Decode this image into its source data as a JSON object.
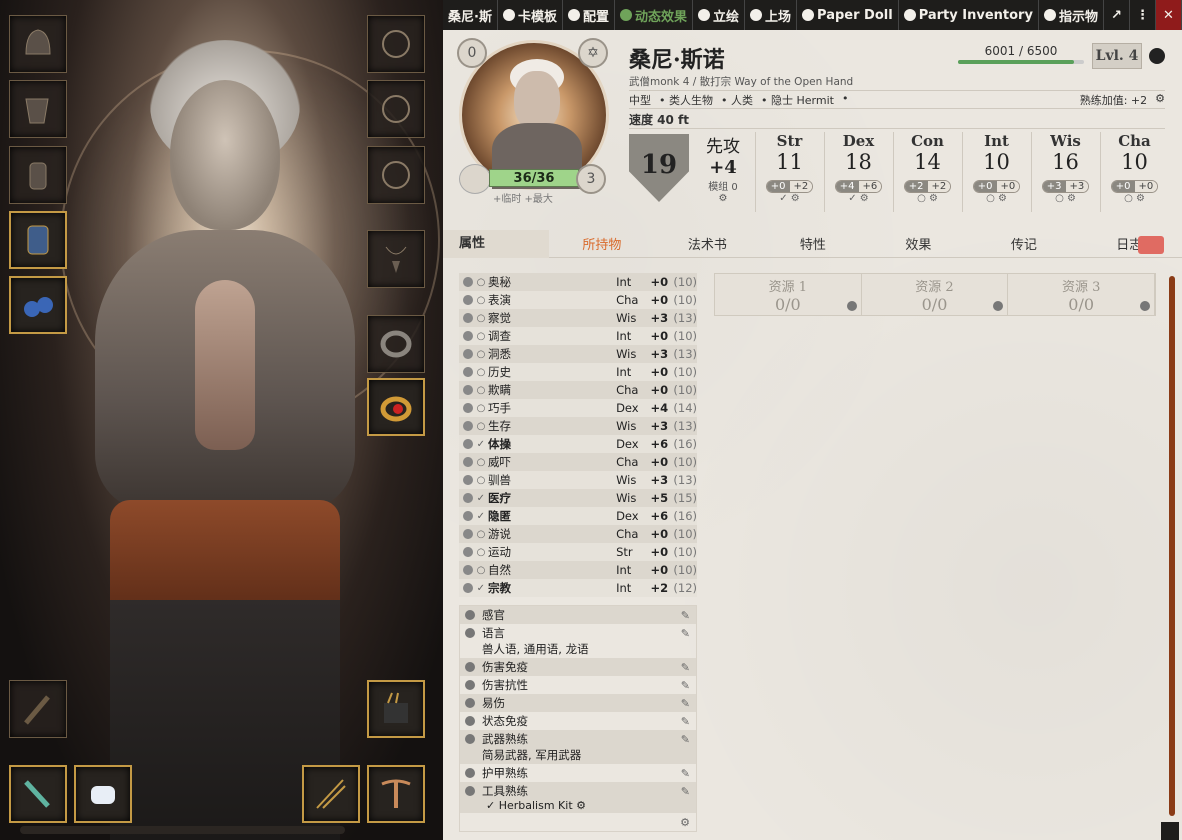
{
  "toolbar": {
    "tabs": [
      {
        "label": "桑尼·斯",
        "icon": "none"
      },
      {
        "label": "卡模板",
        "icon": "gear-icon"
      },
      {
        "label": "配置",
        "icon": "crown-icon"
      },
      {
        "label": "动态效果",
        "icon": "wrench-icon"
      },
      {
        "label": "立绘",
        "icon": "user-tie-icon"
      },
      {
        "label": "上场",
        "icon": "masks-icon"
      },
      {
        "label": "Paper Doll",
        "icon": "figure-icon"
      },
      {
        "label": "Party Inventory",
        "icon": "group-icon"
      },
      {
        "label": "指示物",
        "icon": "user-circle-icon"
      }
    ],
    "external": "↗",
    "menu": "⋮",
    "close": "✕"
  },
  "header": {
    "name": "桑尼·斯诺",
    "class_line": "武僧monk 4 / 散打宗 Way of the Open Hand",
    "inspiration": "0",
    "xp": "6001 / 6500",
    "xp_fraction": 0.923,
    "level": "Lvl. 4",
    "size": "中型",
    "type": "类人生物",
    "race": "人类",
    "background": "隐士 Hermit",
    "proficiency": "熟练加值: +2",
    "speed": "速度 40 ft",
    "hp": "36/36",
    "hit_dice": "3",
    "temp": "+临时 +最大"
  },
  "ac": "19",
  "initiative": {
    "label": "先攻",
    "value": "+4",
    "mod_label": "模组",
    "mod_value": "0"
  },
  "abilities": [
    {
      "name": "Str",
      "score": "11",
      "mod": "+0",
      "save": "+2",
      "prof": true
    },
    {
      "name": "Dex",
      "score": "18",
      "mod": "+4",
      "save": "+6",
      "prof": true
    },
    {
      "name": "Con",
      "score": "14",
      "mod": "+2",
      "save": "+2",
      "prof": false
    },
    {
      "name": "Int",
      "score": "10",
      "mod": "+0",
      "save": "+0",
      "prof": false
    },
    {
      "name": "Wis",
      "score": "16",
      "mod": "+3",
      "save": "+3",
      "prof": false
    },
    {
      "name": "Cha",
      "score": "10",
      "mod": "+0",
      "save": "+0",
      "prof": false
    }
  ],
  "tabs": [
    "属性",
    "所持物",
    "法术书",
    "特性",
    "效果",
    "传记",
    "日志"
  ],
  "skills": [
    {
      "name": "奥秘",
      "ab": "Int",
      "mod": "+0",
      "pass": "(10)",
      "prof": false
    },
    {
      "name": "表演",
      "ab": "Cha",
      "mod": "+0",
      "pass": "(10)",
      "prof": false
    },
    {
      "name": "察觉",
      "ab": "Wis",
      "mod": "+3",
      "pass": "(13)",
      "prof": false
    },
    {
      "name": "调查",
      "ab": "Int",
      "mod": "+0",
      "pass": "(10)",
      "prof": false
    },
    {
      "name": "洞悉",
      "ab": "Wis",
      "mod": "+3",
      "pass": "(13)",
      "prof": false
    },
    {
      "name": "历史",
      "ab": "Int",
      "mod": "+0",
      "pass": "(10)",
      "prof": false
    },
    {
      "name": "欺瞒",
      "ab": "Cha",
      "mod": "+0",
      "pass": "(10)",
      "prof": false
    },
    {
      "name": "巧手",
      "ab": "Dex",
      "mod": "+4",
      "pass": "(14)",
      "prof": false
    },
    {
      "name": "生存",
      "ab": "Wis",
      "mod": "+3",
      "pass": "(13)",
      "prof": false
    },
    {
      "name": "体操",
      "ab": "Dex",
      "mod": "+6",
      "pass": "(16)",
      "prof": true
    },
    {
      "name": "威吓",
      "ab": "Cha",
      "mod": "+0",
      "pass": "(10)",
      "prof": false
    },
    {
      "name": "驯兽",
      "ab": "Wis",
      "mod": "+3",
      "pass": "(13)",
      "prof": false
    },
    {
      "name": "医疗",
      "ab": "Wis",
      "mod": "+5",
      "pass": "(15)",
      "prof": true
    },
    {
      "name": "隐匿",
      "ab": "Dex",
      "mod": "+6",
      "pass": "(16)",
      "prof": true
    },
    {
      "name": "游说",
      "ab": "Cha",
      "mod": "+0",
      "pass": "(10)",
      "prof": false
    },
    {
      "name": "运动",
      "ab": "Str",
      "mod": "+0",
      "pass": "(10)",
      "prof": false
    },
    {
      "name": "自然",
      "ab": "Int",
      "mod": "+0",
      "pass": "(10)",
      "prof": false
    },
    {
      "name": "宗教",
      "ab": "Int",
      "mod": "+2",
      "pass": "(12)",
      "prof": true
    }
  ],
  "traits": [
    {
      "label": "感官",
      "sub": ""
    },
    {
      "label": "语言",
      "sub": "兽人语, 通用语, 龙语"
    },
    {
      "label": "伤害免疫",
      "sub": ""
    },
    {
      "label": "伤害抗性",
      "sub": ""
    },
    {
      "label": "易伤",
      "sub": ""
    },
    {
      "label": "状态免疫",
      "sub": ""
    },
    {
      "label": "武器熟练",
      "sub": "简易武器, 军用武器"
    },
    {
      "label": "护甲熟练",
      "sub": ""
    },
    {
      "label": "工具熟练",
      "sub": "Herbalism Kit"
    }
  ],
  "resources": [
    {
      "label": "资源 1",
      "value": "0/0"
    },
    {
      "label": "资源 2",
      "value": "0/0"
    },
    {
      "label": "资源 3",
      "value": "0/0"
    }
  ],
  "doll_slots": [
    {
      "name": "helmet-slot",
      "filled": false
    },
    {
      "name": "shoulders-slot",
      "filled": false
    },
    {
      "name": "bracers-slot",
      "filled": false
    },
    {
      "name": "gauntlets-slot",
      "filled": true
    },
    {
      "name": "boots-slot",
      "filled": true
    },
    {
      "name": "head-slot-right",
      "filled": false
    },
    {
      "name": "neck-slot-right",
      "filled": false
    },
    {
      "name": "chest-slot-right",
      "filled": false
    },
    {
      "name": "amulet-slot",
      "filled": false
    },
    {
      "name": "ring-slot-1",
      "filled": false
    },
    {
      "name": "ring-slot-2",
      "filled": true
    },
    {
      "name": "mace-slot",
      "filled": false
    },
    {
      "name": "quiver-slot",
      "filled": true
    },
    {
      "name": "sword-slot",
      "filled": true
    },
    {
      "name": "unarmed-slot",
      "filled": true
    },
    {
      "name": "arrows-slot",
      "filled": true
    },
    {
      "name": "crossbow-slot",
      "filled": true
    }
  ]
}
